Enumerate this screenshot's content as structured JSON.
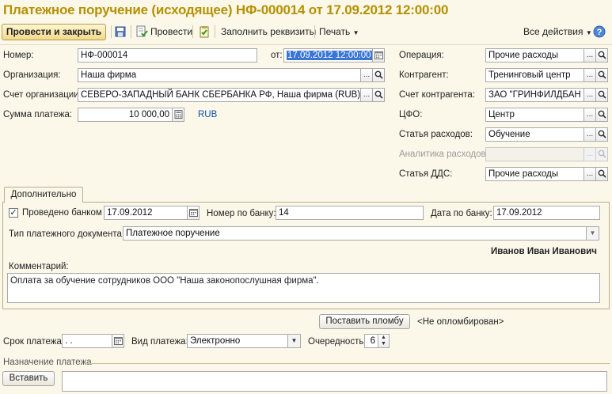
{
  "title": "Платежное поручение (исходящее) НФ-000014 от 17.09.2012 12:00:00",
  "toolbar": {
    "post_close": "Провести и закрыть",
    "post": "Провести",
    "fill_details": "Заполнить реквизиты",
    "print": "Печать",
    "all_actions": "Все действия"
  },
  "form": {
    "number_label": "Номер:",
    "number_value": "НФ-000014",
    "date_label": "от:",
    "date_value": "17.09.2012 12:00:00",
    "org_label": "Организация:",
    "org_value": "Наша фирма",
    "account_label": "Счет организации:",
    "account_value": "СЕВЕРО-ЗАПАДНЫЙ БАНК СБЕРБАНКА РФ, Наша фирма (RUB)",
    "amount_label": "Сумма платежа:",
    "amount_value": "10 000,00",
    "currency": "RUB",
    "operation_label": "Операция:",
    "operation_value": "Прочие расходы",
    "counterparty_label": "Контрагент:",
    "counterparty_value": "Тренинговый центр",
    "cp_account_label": "Счет контрагента:",
    "cp_account_value": "ЗАО \"ГРИНФИЛДБАН",
    "cfo_label": "ЦФО:",
    "cfo_value": "Центр",
    "expense_item_label": "Статья расходов:",
    "expense_item_value": "Обучение",
    "expense_analytics_label": "Аналитика расходов:",
    "expense_analytics_value": "",
    "dds_label": "Статья ДДС:",
    "dds_value": "Прочие расходы"
  },
  "extra": {
    "tab_label": "Дополнительно",
    "bank_checked": true,
    "bank_label": "Проведено банком",
    "bank_date": "17.09.2012",
    "bank_number_label": "Номер по банку:",
    "bank_number_value": "14",
    "bank_date_label": "Дата по банку:",
    "bank_date_value": "17.09.2012",
    "doc_type_label": "Тип платежного документа:",
    "doc_type_value": "Платежное поручение",
    "responsible": "Иванов Иван Иванович",
    "comment_label": "Комментарий:",
    "comment_value": "Оплата за обучение сотрудников ООО \"Наша законопослушная фирма\"."
  },
  "seal": {
    "button": "Поставить пломбу",
    "status": "<Не опломбирован>"
  },
  "payment": {
    "due_label": "Срок платежа:",
    "due_value": " .  .",
    "type_label": "Вид платежа:",
    "type_value": "Электронно",
    "priority_label": "Очередность:",
    "priority_value": "6"
  },
  "purpose": {
    "group_label": "Назначение платежа",
    "insert_button": "Вставить",
    "value": ""
  }
}
